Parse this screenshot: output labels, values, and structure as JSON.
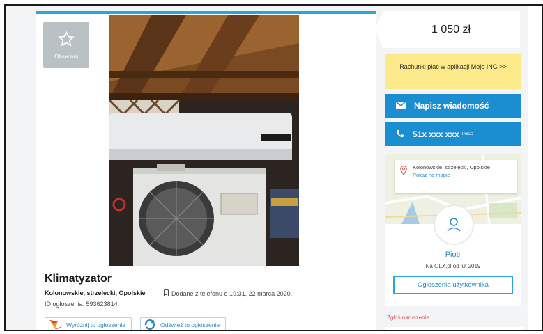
{
  "ad": {
    "observe_label": "Obserwuj",
    "title": "Klimatyzator",
    "location": "Kolonowskie, strzelecki, Opolskie",
    "added": "Dodane z telefonu  o 19:31, 22 marca 2020,",
    "id_text": "ID ogłoszenia: 593623814",
    "highlight_button": "Wyróżnij to ogłoszenie",
    "refresh_button": "Odśwież to ogłoszenie"
  },
  "sidebar": {
    "price": "1 050 zł",
    "ing_banner": "Rachunki płać w aplikacji Moje ING >>",
    "message_button": "Napisz wiadomość",
    "phone_number": "51x xxx xxx",
    "phone_reveal": "Pokaż",
    "map_location": "Kolonowskie, strzelecki, Opolskie",
    "map_link": "Pokaż na mapie",
    "user_name": "Piotr",
    "user_since": "Na OLX.pl od lut 2019",
    "user_ads_button": "Ogłoszenia użytkownika",
    "report": "Zgłoś naruszenie"
  },
  "colors": {
    "accent_blue": "#1b8ed2",
    "link_blue": "#2a88c4",
    "ing_yellow": "#fbe98a",
    "report_red": "#d9534f"
  }
}
